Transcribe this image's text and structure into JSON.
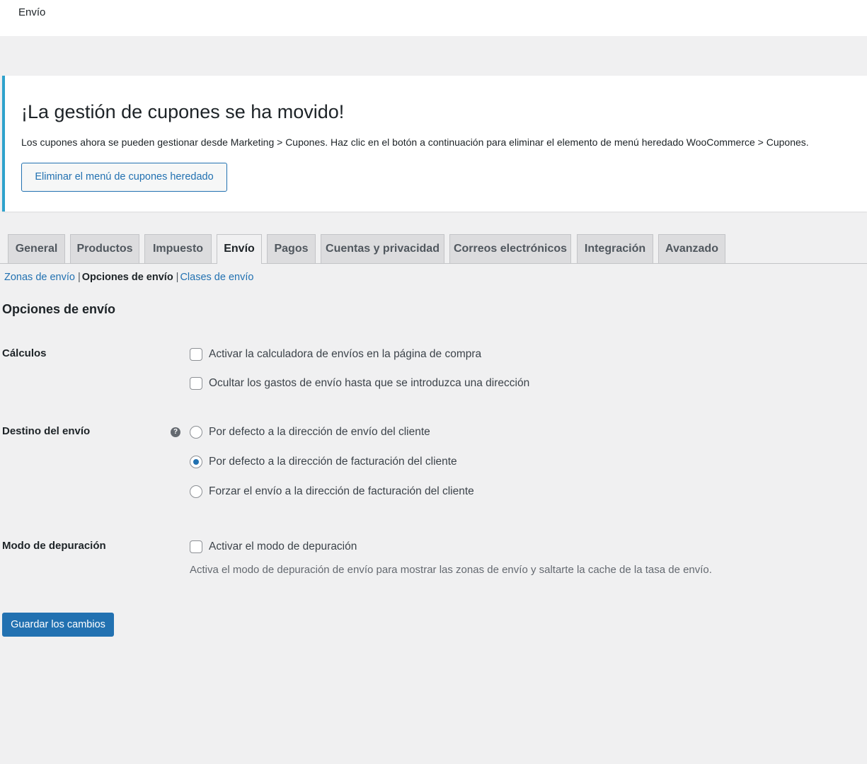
{
  "header": {
    "title": "Envío"
  },
  "notice": {
    "title": "¡La gestión de cupones se ha movido!",
    "text": "Los cupones ahora se pueden gestionar desde Marketing > Cupones. Haz clic en el botón a continuación para eliminar el elemento de menú heredado WooCommerce > Cupones.",
    "button_label": "Eliminar el menú de cupones heredado"
  },
  "tabs": [
    {
      "label": "General"
    },
    {
      "label": "Productos"
    },
    {
      "label": "Impuesto"
    },
    {
      "label": "Envío",
      "active": true
    },
    {
      "label": "Pagos"
    },
    {
      "label": "Cuentas y privacidad"
    },
    {
      "label": "Correos electrónicos"
    },
    {
      "label": "Integración"
    },
    {
      "label": "Avanzado"
    }
  ],
  "subnav": {
    "zones": "Zonas de envío",
    "options": "Opciones de envío",
    "classes": "Clases de envío",
    "separator": "|"
  },
  "section_title": "Opciones de envío",
  "calculations": {
    "label": "Cálculos",
    "options": [
      {
        "label": "Activar la calculadora de envíos en la página de compra",
        "checked": false
      },
      {
        "label": "Ocultar los gastos de envío hasta que se introduzca una dirección",
        "checked": false
      }
    ]
  },
  "destination": {
    "label": "Destino del envío",
    "help_icon": "?",
    "options": [
      {
        "label": "Por defecto a la dirección de envío del cliente",
        "checked": false
      },
      {
        "label": "Por defecto a la dirección de facturación del cliente",
        "checked": true
      },
      {
        "label": "Forzar el envío a la dirección de facturación del cliente",
        "checked": false
      }
    ]
  },
  "debug": {
    "label": "Modo de depuración",
    "option": {
      "label": "Activar el modo de depuración",
      "checked": false
    },
    "description": "Activa el modo de depuración de envío para mostrar las zonas de envío y saltarte la cache de la tasa de envío."
  },
  "save_label": "Guardar los cambios",
  "colors": {
    "accent": "#2271b1",
    "notice_border": "#2ea2cc",
    "background": "#f0f0f1"
  }
}
